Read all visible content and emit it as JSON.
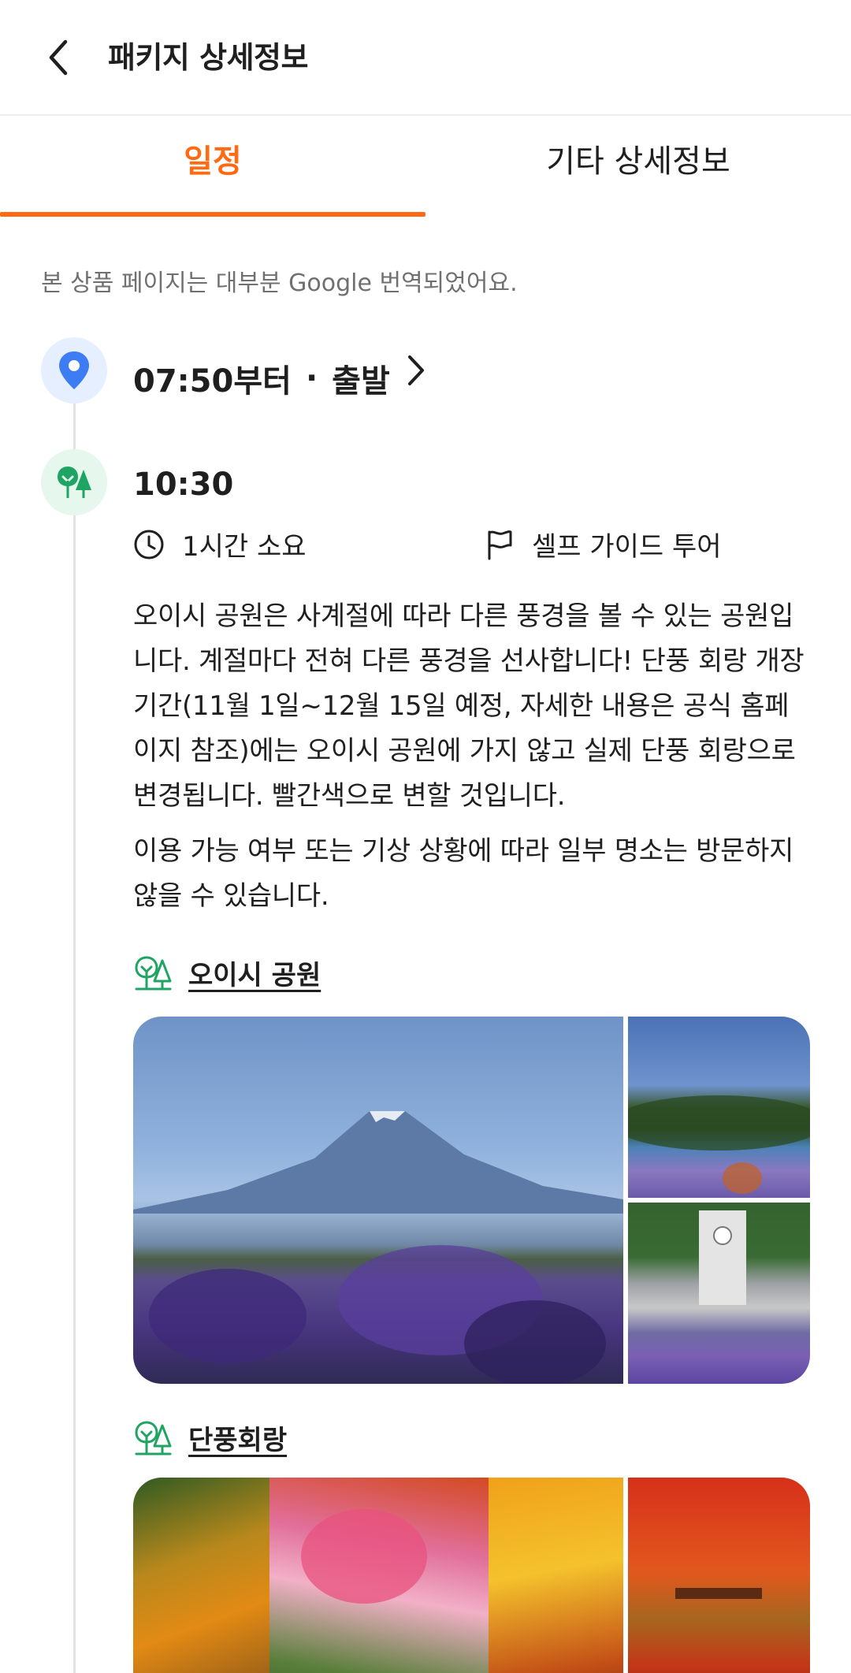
{
  "header": {
    "title": "패키지 상세정보",
    "back_icon": "chevron-left-icon"
  },
  "tabs": [
    {
      "label": "일정",
      "active": true
    },
    {
      "label": "기타 상세정보",
      "active": false
    }
  ],
  "notice": "본 상품 페이지는 대부분 Google 번역되었어요.",
  "colors": {
    "accent": "#ff6a13",
    "start_pin": "#3d7cf2",
    "park_green": "#1fa463"
  },
  "timeline": {
    "start": {
      "icon": "location-pin-icon",
      "time_label": "07:50부터",
      "separator": "·",
      "status": "출발"
    },
    "stop": {
      "icon": "trees-icon",
      "time": "10:30",
      "duration": "1시간 소요",
      "guide_type": "셀프 가이드 투어",
      "description_1": "오이시 공원은 사계절에 따라 다른 풍경을 볼 수 있는 공원입니다. 계절마다 전혀 다른 풍경을 선사합니다! 단풍 회랑 개장 기간(11월 1일~12월 15일 예정, 자세한 내용은 공식 홈페이지 참조)에는 오이시 공원에 가지 않고 실제 단풍 회랑으로 변경됩니다. 빨간색으로 변할 것입니다.",
      "description_2": "이용 가능 여부 또는 기상 상황에 따라 일부 명소는 방문하지 않을 수 있습니다.",
      "places": [
        {
          "name": "오이시 공원",
          "icon": "trees-icon"
        },
        {
          "name": "단풍회랑",
          "icon": "trees-icon"
        }
      ]
    }
  }
}
